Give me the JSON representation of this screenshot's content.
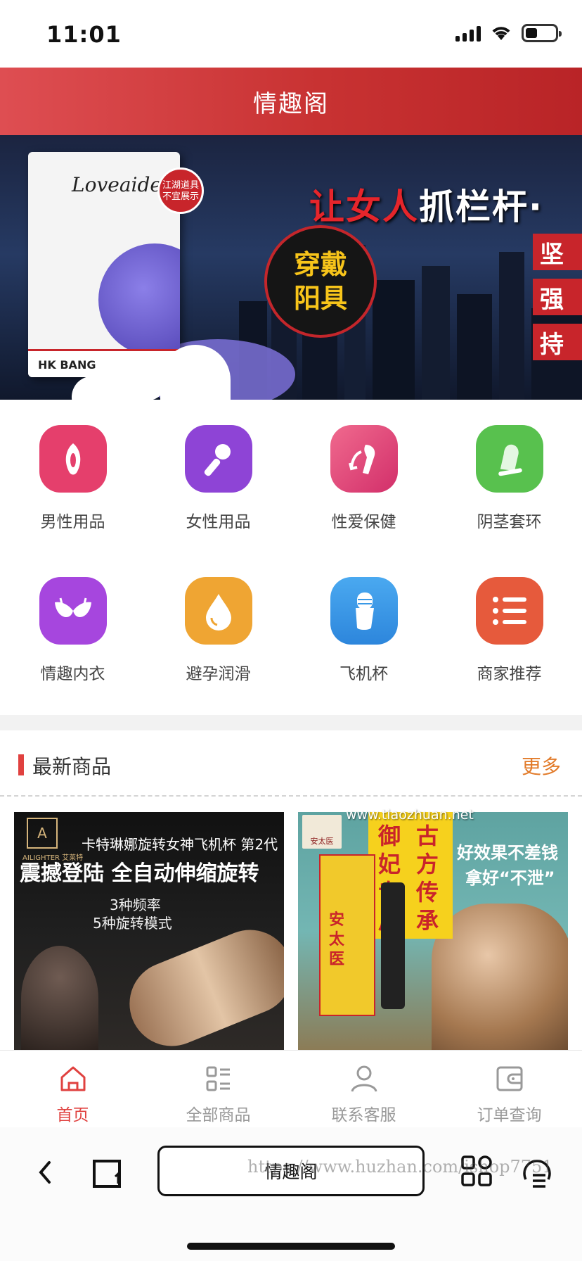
{
  "status_bar": {
    "time": "11:01"
  },
  "header": {
    "title": "情趣阁"
  },
  "banner": {
    "brand": "Loveaider",
    "box_bottom": "HK BANG",
    "badge": "江湖道具 不宜展示",
    "headline_red": "让女人",
    "headline_white": "抓栏杆·",
    "bubble_line1": "穿戴",
    "bubble_line2": "阳具",
    "tags": [
      "坚",
      "强",
      "持"
    ]
  },
  "categories": [
    {
      "label": "男性用品",
      "icon": "male-products-icon",
      "color": "#e53f6c"
    },
    {
      "label": "女性用品",
      "icon": "microphone-wand-icon",
      "color": "#8e44d6"
    },
    {
      "label": "性爱保健",
      "icon": "health-care-icon",
      "color": "#e3417a"
    },
    {
      "label": "阴茎套环",
      "icon": "condom-icon",
      "color": "#58c14e"
    },
    {
      "label": "情趣内衣",
      "icon": "bra-icon",
      "color": "#a646de"
    },
    {
      "label": "避孕润滑",
      "icon": "droplet-icon",
      "color": "#efa533"
    },
    {
      "label": "飞机杯",
      "icon": "cup-icon",
      "color": "#3a99e6"
    },
    {
      "label": "商家推荐",
      "icon": "list-icon",
      "color": "#e65a3c"
    }
  ],
  "section": {
    "title": "最新商品",
    "more": "更多"
  },
  "products": [
    {
      "logo": "A",
      "brand": "AILIGHTER 艾莱特",
      "title": "卡特琳娜旋转女神飞机杯 第2代",
      "headline": "震撼登陆 全自动伸缩旋转",
      "sub1": "3种频率",
      "sub2": "5种旋转模式"
    },
    {
      "logo": "安太医",
      "col1": "御妃专用",
      "col2": "古方传承",
      "slogan1": "好效果不差钱",
      "slogan2": "拿好“不泄”",
      "box_text": "安太医"
    }
  ],
  "tabbar": [
    {
      "label": "首页",
      "icon": "home-icon",
      "active": true
    },
    {
      "label": "全部商品",
      "icon": "grid-list-icon",
      "active": false
    },
    {
      "label": "联系客服",
      "icon": "user-icon",
      "active": false
    },
    {
      "label": "订单查询",
      "icon": "wallet-icon",
      "active": false
    }
  ],
  "browser": {
    "url_text": "情趣阁"
  },
  "watermarks": {
    "top": "www.tiaozhuan.net",
    "bottom": "https://www.huzhan.com/ishop7751"
  },
  "colors": {
    "header": "#c83232",
    "accent": "#e0413f",
    "more": "#e27b2a"
  }
}
